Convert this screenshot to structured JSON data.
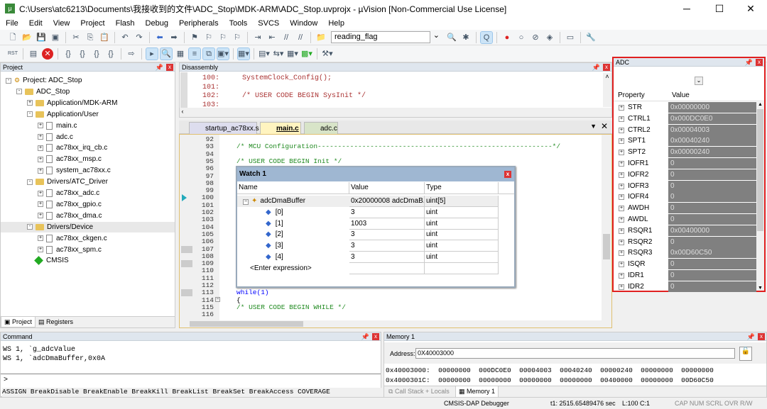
{
  "window": {
    "title": "C:\\Users\\atc6213\\Documents\\我接收到的文件\\ADC_Stop\\MDK-ARM\\ADC_Stop.uvprojx - µVision  [Non-Commercial Use License]"
  },
  "menu": [
    "File",
    "Edit",
    "View",
    "Project",
    "Flash",
    "Debug",
    "Peripherals",
    "Tools",
    "SVCS",
    "Window",
    "Help"
  ],
  "toolbar": {
    "find_combo": "reading_flag"
  },
  "project": {
    "title": "Project",
    "tree": [
      {
        "label": "Project: ADC_Stop",
        "level": 0,
        "kind": "project",
        "exp": "-"
      },
      {
        "label": "ADC_Stop",
        "level": 1,
        "kind": "target",
        "exp": "-"
      },
      {
        "label": "Application/MDK-ARM",
        "level": 2,
        "kind": "folder",
        "exp": "+"
      },
      {
        "label": "Application/User",
        "level": 2,
        "kind": "folder",
        "exp": "-"
      },
      {
        "label": "main.c",
        "level": 3,
        "kind": "file",
        "exp": "+"
      },
      {
        "label": "adc.c",
        "level": 3,
        "kind": "file",
        "exp": "+"
      },
      {
        "label": "ac78xx_irq_cb.c",
        "level": 3,
        "kind": "file",
        "exp": "+"
      },
      {
        "label": "ac78xx_msp.c",
        "level": 3,
        "kind": "file",
        "exp": "+"
      },
      {
        "label": "system_ac78xx.c",
        "level": 3,
        "kind": "file",
        "exp": "+"
      },
      {
        "label": "Drivers/ATC_Driver",
        "level": 2,
        "kind": "folder",
        "exp": "-"
      },
      {
        "label": "ac78xx_adc.c",
        "level": 3,
        "kind": "file",
        "exp": "+"
      },
      {
        "label": "ac78xx_gpio.c",
        "level": 3,
        "kind": "file",
        "exp": "+"
      },
      {
        "label": "ac78xx_dma.c",
        "level": 3,
        "kind": "file",
        "exp": "+"
      },
      {
        "label": "Drivers/Device",
        "level": 2,
        "kind": "folder",
        "exp": "-",
        "selected": true
      },
      {
        "label": "ac78xx_ckgen.c",
        "level": 3,
        "kind": "file",
        "exp": "+"
      },
      {
        "label": "ac78xx_spm.c",
        "level": 3,
        "kind": "file",
        "exp": "+"
      },
      {
        "label": "CMSIS",
        "level": 2,
        "kind": "gem",
        "exp": ""
      }
    ],
    "tabs": [
      "Project",
      "Registers"
    ]
  },
  "disassembly": {
    "title": "Disassembly",
    "lines": [
      {
        "n": "100:",
        "code": "SystemClock_Config();"
      },
      {
        "n": "101:",
        "code": ""
      },
      {
        "n": "102:",
        "code": "/* USER CODE BEGIN SysInit */"
      },
      {
        "n": "103:",
        "code": ""
      }
    ]
  },
  "editor": {
    "tabs": [
      "startup_ac78xx.s",
      "main.c",
      "adc.c"
    ],
    "active_tab": "main.c",
    "line_numbers": [
      "92",
      "93",
      "94",
      "95",
      "96",
      "97",
      "98",
      "99",
      "100",
      "101",
      "102",
      "103",
      "104",
      "105",
      "106",
      "107",
      "108",
      "109",
      "110",
      "111",
      "112",
      "113",
      "114",
      "115",
      "116"
    ],
    "code": [
      {
        "line": "93",
        "text": "/* MCU Configuration----------------------------------------------------------*/",
        "color": "#228b22"
      },
      {
        "line": "95",
        "text": "/* USER CODE BEGIN Init */",
        "color": "#228b22"
      },
      {
        "line": "113",
        "text": "while(1)",
        "color": "#0000ff"
      },
      {
        "line": "114",
        "text": "{",
        "color": "#000000"
      },
      {
        "line": "115",
        "text": "/* USER CODE BEGIN WHILE */",
        "color": "#228b22"
      }
    ],
    "current_line": "100"
  },
  "watch": {
    "title": "Watch 1",
    "columns": [
      "Name",
      "Value",
      "Type"
    ],
    "rows": [
      {
        "name": "adcDmaBuffer",
        "value": "0x20000008 adcDmaB...",
        "type": "uint[5]"
      },
      {
        "name": "[0]",
        "value": "3",
        "type": "uint"
      },
      {
        "name": "[1]",
        "value": "1003",
        "type": "uint"
      },
      {
        "name": "[2]",
        "value": "3",
        "type": "uint"
      },
      {
        "name": "[3]",
        "value": "3",
        "type": "uint"
      },
      {
        "name": "[4]",
        "value": "3",
        "type": "uint"
      }
    ],
    "enter": "<Enter expression>"
  },
  "adc": {
    "title": "ADC",
    "columns": [
      "Property",
      "Value"
    ],
    "rows": [
      {
        "n": "STR",
        "v": "0x00000000"
      },
      {
        "n": "CTRL1",
        "v": "0x000DC0E0"
      },
      {
        "n": "CTRL2",
        "v": "0x00004003"
      },
      {
        "n": "SPT1",
        "v": "0x00040240"
      },
      {
        "n": "SPT2",
        "v": "0x00000240"
      },
      {
        "n": "IOFR1",
        "v": "0"
      },
      {
        "n": "IOFR2",
        "v": "0"
      },
      {
        "n": "IOFR3",
        "v": "0"
      },
      {
        "n": "IOFR4",
        "v": "0"
      },
      {
        "n": "AWDH",
        "v": "0"
      },
      {
        "n": "AWDL",
        "v": "0"
      },
      {
        "n": "RSQR1",
        "v": "0x00400000"
      },
      {
        "n": "RSQR2",
        "v": "0"
      },
      {
        "n": "RSQR3",
        "v": "0x00D60C50"
      },
      {
        "n": "ISQR",
        "v": "0"
      },
      {
        "n": "IDR1",
        "v": "0"
      },
      {
        "n": "IDR2",
        "v": "0"
      }
    ],
    "highlight_color": "#e02020"
  },
  "command": {
    "title": "Command",
    "output": [
      "WS 1, `g_adcValue",
      "WS 1, `adcDmaBuffer,0x0A"
    ],
    "prompt": ">",
    "hints": "ASSIGN BreakDisable BreakEnable BreakKill BreakList BreakSet BreakAccess COVERAGE"
  },
  "memory": {
    "title": "Memory 1",
    "address_label": "Address:",
    "address": "0X40003000",
    "rows": [
      {
        "addr": "0x40003000:",
        "words": "00000000  000DC0E0  00004003  00040240  00000240  00000000  00000000"
      },
      {
        "addr": "0x4000301C:",
        "words": "00000000  00000000  00000000  00000000  00400000  00000000  00D60C50"
      }
    ],
    "tabs": [
      "Call Stack + Locals",
      "Memory 1"
    ]
  },
  "status": {
    "debugger": "CMSIS-DAP Debugger",
    "time": "t1: 2515.65489476 sec",
    "pos": "L:100 C:1",
    "flags": "CAP NUM SCRL OVR R/W"
  }
}
